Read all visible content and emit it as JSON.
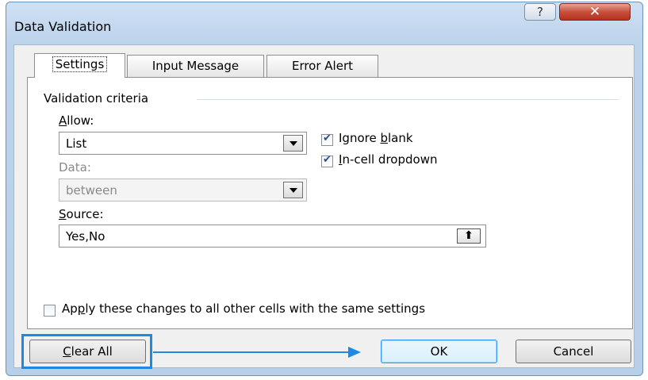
{
  "window": {
    "title": "Data Validation",
    "help_symbol": "?",
    "close_symbol": "✕"
  },
  "tabs": [
    {
      "label": "Settings",
      "active": true
    },
    {
      "label": "Input Message",
      "active": false
    },
    {
      "label": "Error Alert",
      "active": false
    }
  ],
  "settings": {
    "group_label": "Validation criteria",
    "allow": {
      "label": "Allow:",
      "value": "List"
    },
    "data": {
      "label": "Data:",
      "value": "between"
    },
    "ignore_blank": {
      "label": "Ignore blank",
      "checked": true
    },
    "in_cell_dropdown": {
      "label": "In-cell dropdown",
      "checked": true
    },
    "source": {
      "label": "Source:",
      "value": "Yes,No",
      "ref_button_icon": "collapse-dialog-icon"
    },
    "apply_all": {
      "label": "Apply these changes to all other cells with the same settings",
      "checked": false
    }
  },
  "buttons": {
    "clear_all": "Clear All",
    "ok": "OK",
    "cancel": "Cancel"
  },
  "annotation": {
    "color": "#1e88e5"
  }
}
